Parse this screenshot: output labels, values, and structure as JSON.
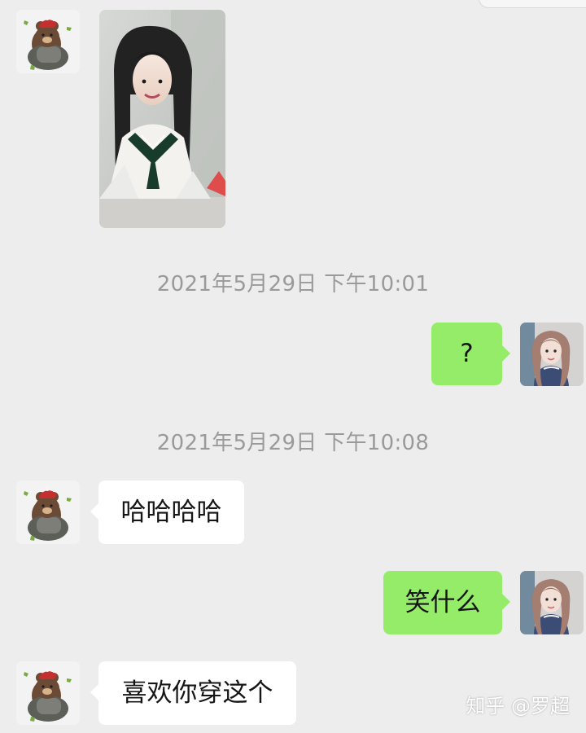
{
  "conversation": {
    "timestamps": [
      "2021年5月29日 下午10:01",
      "2021年5月29日 下午10:08"
    ],
    "messages": {
      "out_1": "?",
      "in_1": "哈哈哈哈",
      "out_2": "笑什么",
      "in_2": "喜欢你穿这个"
    }
  },
  "watermark": "知乎 @罗超",
  "icons": {
    "contact_avatar": "bear-avatar-icon",
    "self_avatar": "girl-avatar-icon",
    "photo": "image-message-icon"
  },
  "colors": {
    "background": "#ededed",
    "incoming_bubble": "#ffffff",
    "outgoing_bubble": "#95ec69",
    "timestamp_text": "#9a9a9a"
  }
}
